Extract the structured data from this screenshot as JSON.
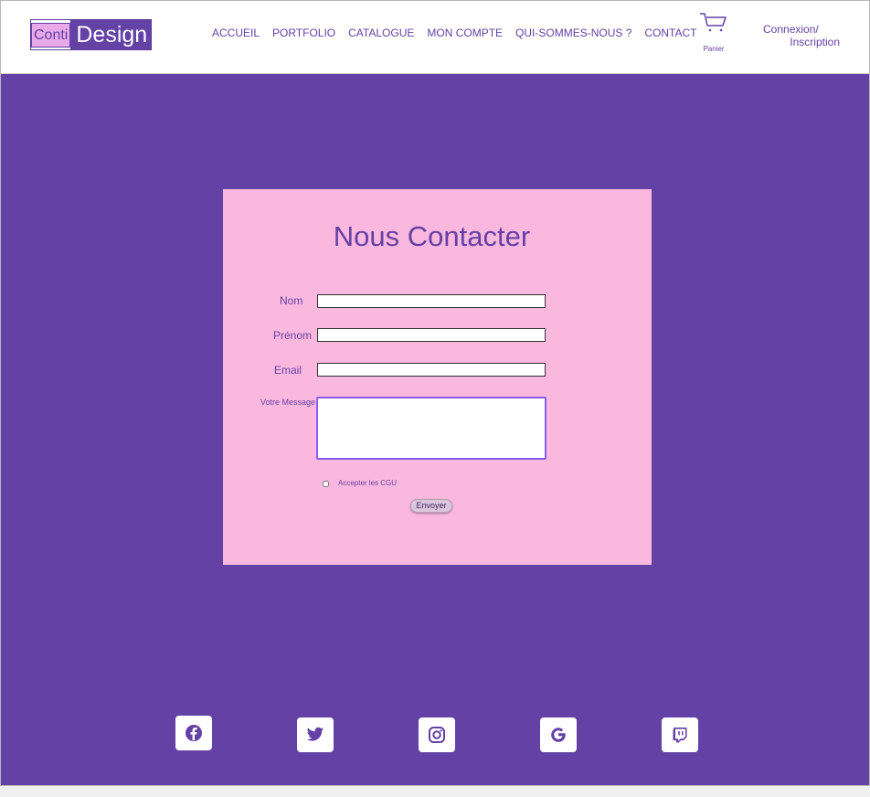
{
  "brand": {
    "part1": "Conti",
    "part2": "Design"
  },
  "nav": {
    "items": [
      "ACCUEIL",
      "PORTFOLIO",
      "CATALOGUE",
      "MON COMPTE",
      "QUI-SOMMES-NOUS ?",
      "CONTACT"
    ]
  },
  "cart": {
    "label": "Panier",
    "icon": "cart-icon"
  },
  "auth": {
    "line1": "Connexion/",
    "line2": "Inscription"
  },
  "form": {
    "title": "Nous Contacter",
    "nom_label": "Nom",
    "prenom_label": "Prénom",
    "email_label": "Email",
    "message_label": "Votre Message",
    "nom_value": "",
    "prenom_value": "",
    "email_value": "",
    "message_value": "",
    "cgu_label": "Accepter les CGU",
    "cgu_checked": false,
    "submit_label": "Envoyer"
  },
  "social": [
    "facebook-icon",
    "twitter-icon",
    "instagram-icon",
    "google-icon",
    "twitch-icon"
  ],
  "colors": {
    "primary": "#6441a5",
    "card": "#fbb8de",
    "logo_accent": "#e8a9ea",
    "header_bg": "#ffffff",
    "message_border": "#8a5cf0"
  }
}
